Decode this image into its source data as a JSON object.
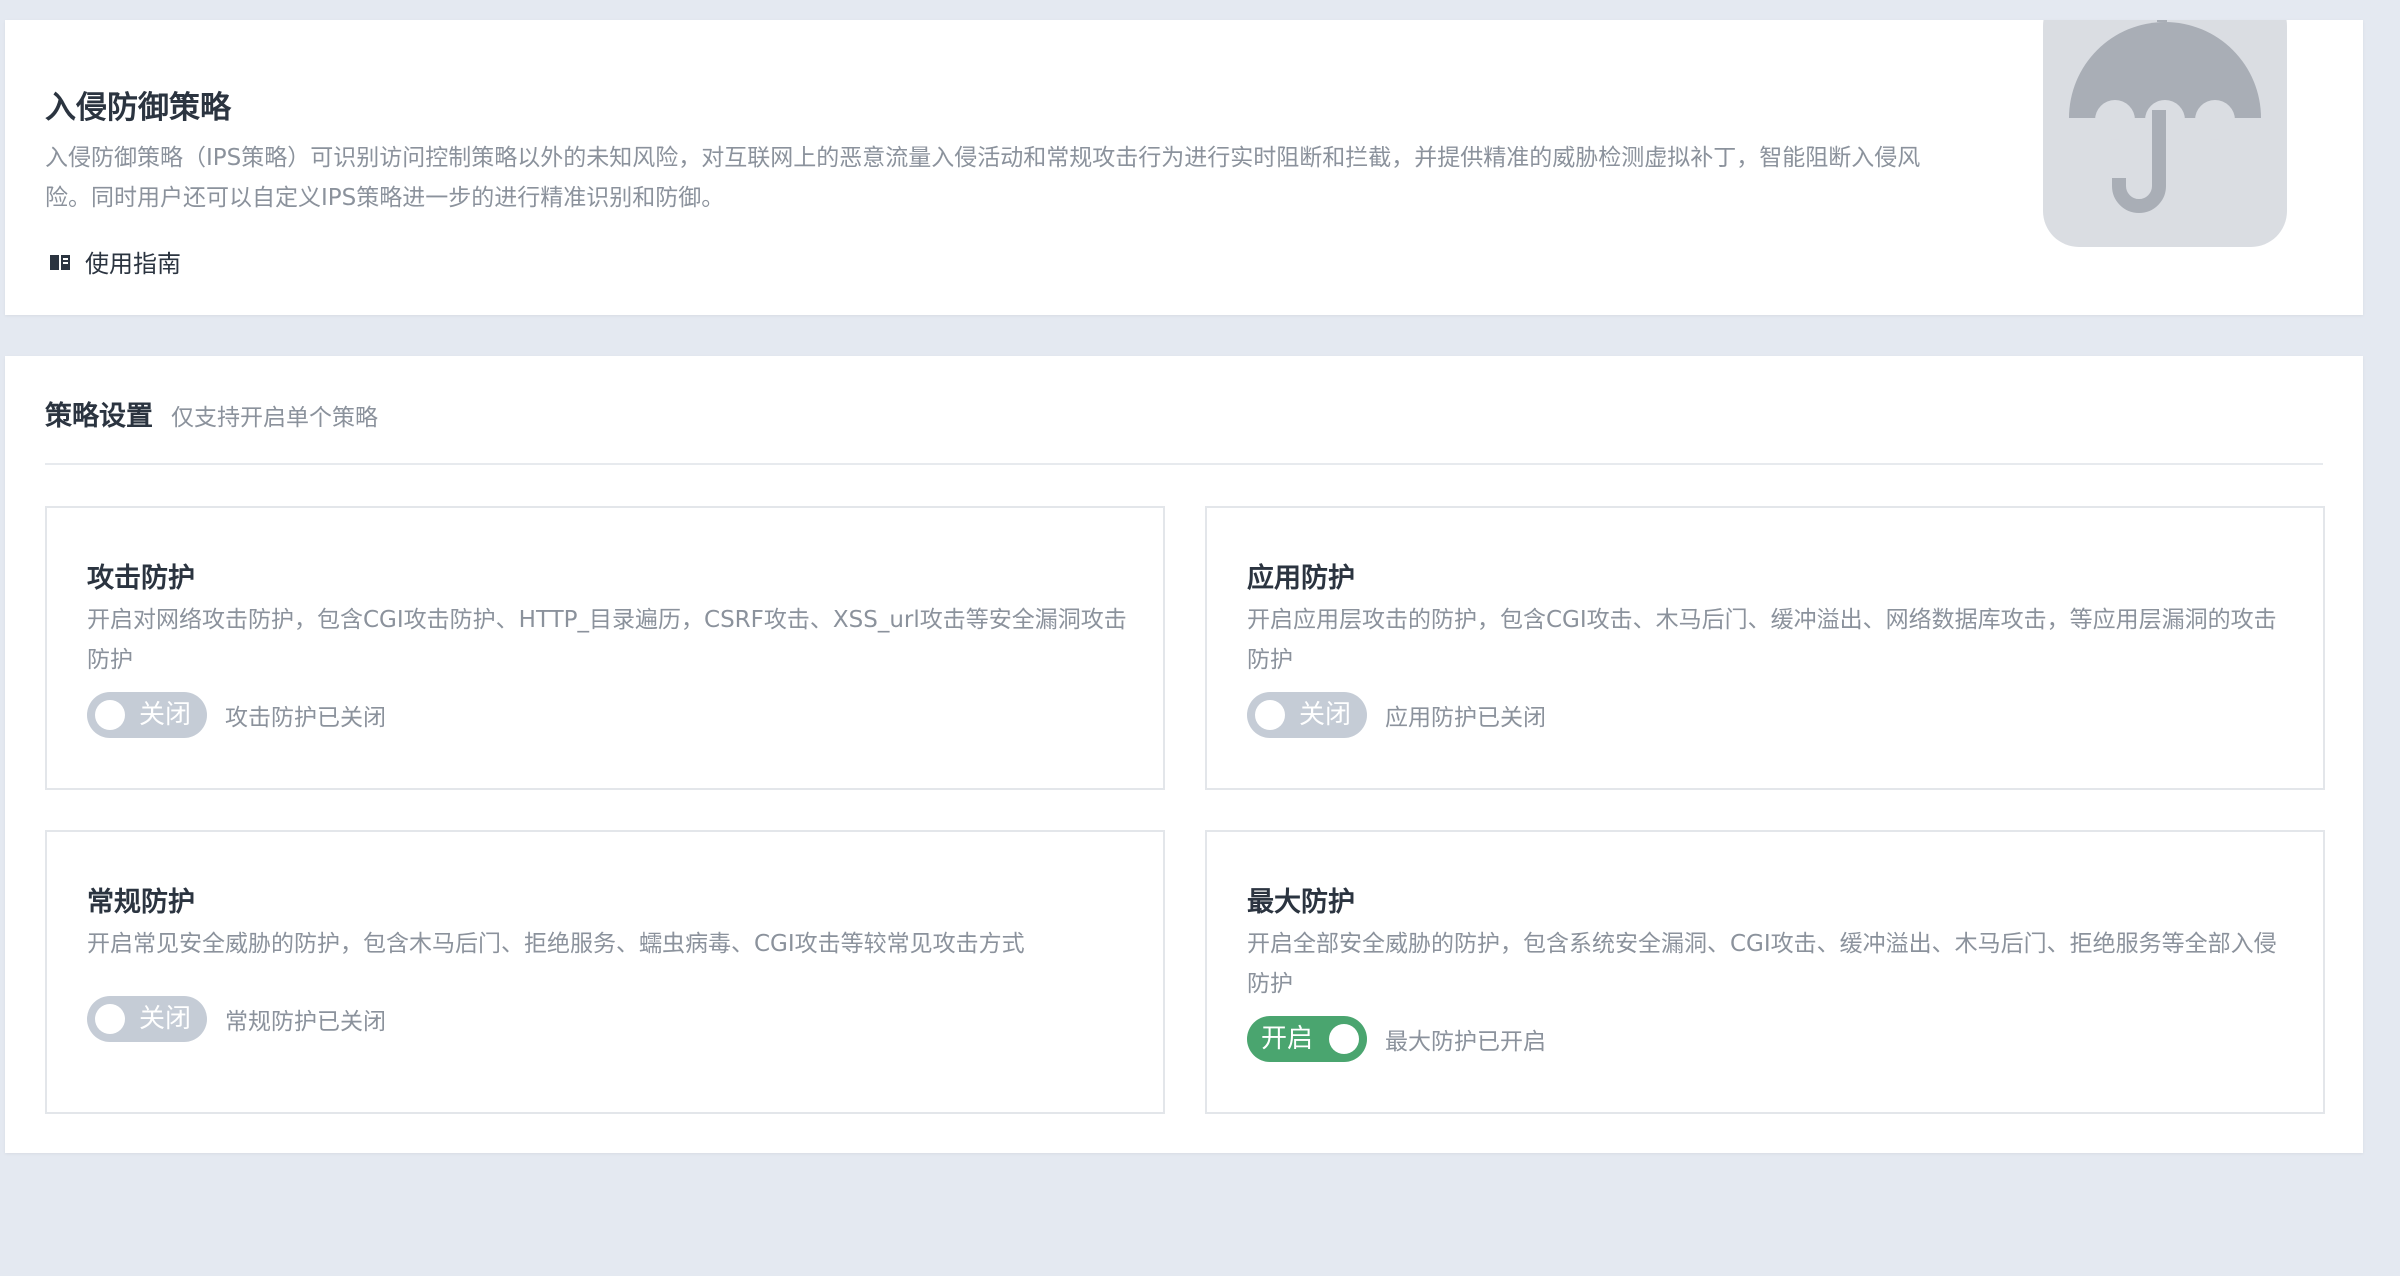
{
  "intro": {
    "title": "入侵防御策略",
    "description": "入侵防御策略（IPS策略）可识别访问控制策略以外的未知风险，对互联网上的恶意流量入侵活动和常规攻击行为进行实时阻断和拦截，并提供精准的威胁检测虚拟补丁，智能阻断入侵风险。同时用户还可以自定义IPS策略进一步的进行精准识别和防御。",
    "guide_link": "使用指南",
    "guide_icon": "book-icon",
    "illustration_icon": "umbrella-icon"
  },
  "policy": {
    "title": "策略设置",
    "subtitle": "仅支持开启单个策略",
    "options": [
      {
        "title": "攻击防护",
        "description": "开启对网络攻击防护，包含CGI攻击防护、HTTP_目录遍历，CSRF攻击、XSS_url攻击等安全漏洞攻击防护",
        "toggle_label": "关闭",
        "enabled": false,
        "status": "攻击防护已关闭"
      },
      {
        "title": "应用防护",
        "description": "开启应用层攻击的防护，包含CGI攻击、木马后门、缓冲溢出、网络数据库攻击，等应用层漏洞的攻击防护",
        "toggle_label": "关闭",
        "enabled": false,
        "status": "应用防护已关闭"
      },
      {
        "title": "常规防护",
        "description": "开启常见安全威胁的防护，包含木马后门、拒绝服务、蠕虫病毒、CGI攻击等较常见攻击方式",
        "toggle_label": "关闭",
        "enabled": false,
        "status": "常规防护已关闭"
      },
      {
        "title": "最大防护",
        "description": "开启全部安全威胁的防护，包含系统安全漏洞、CGI攻击、缓冲溢出、木马后门、拒绝服务等全部入侵防护",
        "toggle_label": "开启",
        "enabled": true,
        "status": "最大防护已开启"
      }
    ]
  },
  "colors": {
    "toggle_on": "#4aa56f",
    "toggle_off": "#c5ccd6",
    "page_background": "#e4e9f1"
  }
}
